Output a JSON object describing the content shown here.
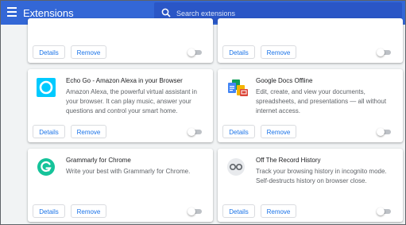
{
  "header": {
    "title": "Extensions",
    "search_placeholder": "Search extensions"
  },
  "buttons": {
    "details": "Details",
    "remove": "Remove"
  },
  "extensions": [
    {
      "name": "Echo Go - Amazon Alexa in your Browser",
      "description": "Amazon Alexa, the powerful virtual assistant in your browser. It can play music, answer your questions and control your smart home.",
      "icon": "alexa-icon",
      "enabled": false
    },
    {
      "name": "Google Docs Offline",
      "description": "Edit, create, and view your documents, spreadsheets, and presentations — all without internet access.",
      "icon": "google-docs-offline-icon",
      "enabled": false
    },
    {
      "name": "Grammarly for Chrome",
      "description": "Write your best with Grammarly for Chrome.",
      "icon": "grammarly-icon",
      "enabled": false
    },
    {
      "name": "Off The Record History",
      "description": "Track your browsing history in incognito mode. Self-destructs history on browser close.",
      "icon": "incognito-glasses-icon",
      "enabled": false
    }
  ],
  "colors": {
    "header": "#3367d6",
    "accent": "#1a73e8",
    "alexa": "#00caff",
    "grammarly": "#15c39a"
  }
}
